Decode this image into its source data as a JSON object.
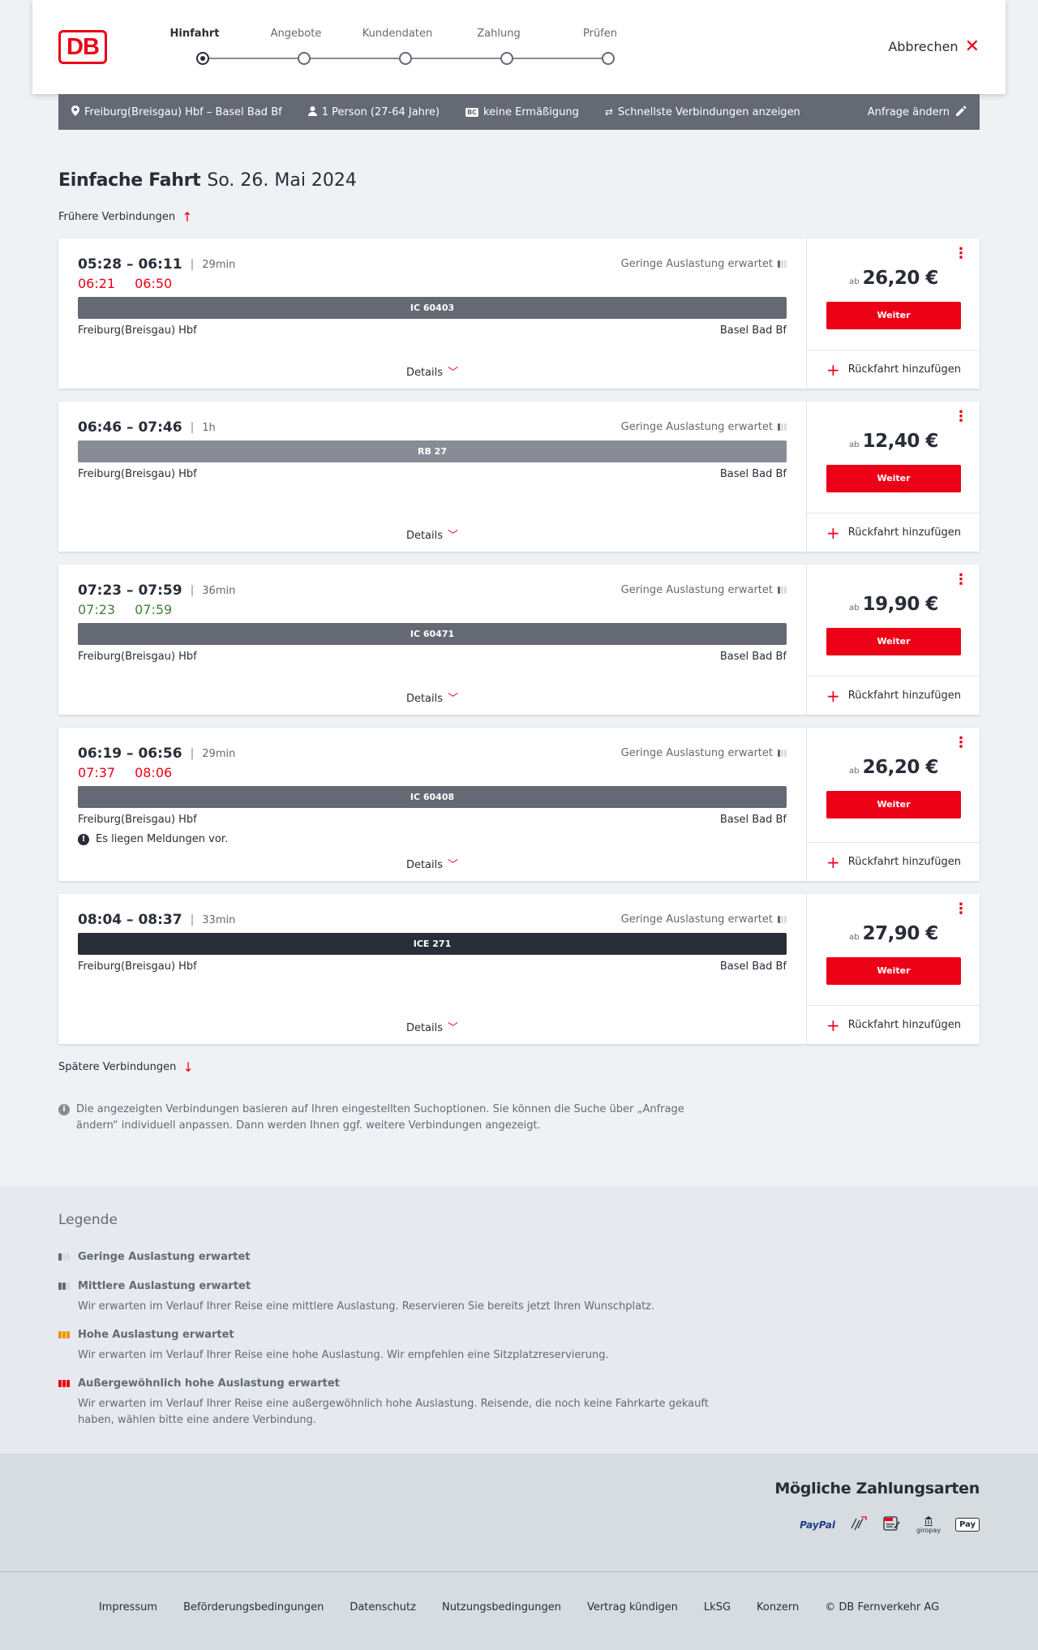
{
  "header": {
    "logo": "DB",
    "steps": [
      "Hinfahrt",
      "Angebote",
      "Kundendaten",
      "Zahlung",
      "Prüfen"
    ],
    "active_step": "Hinfahrt",
    "cancel_label": "Abbrechen"
  },
  "searchbar": {
    "route": "Freiburg(Breisgau) Hbf – Basel Bad Bf",
    "travellers": "1 Person (27-64 Jahre)",
    "discount": "keine Ermäßigung",
    "discount_badge": "BC",
    "fastest": "Schnellste Verbindungen anzeigen",
    "edit_label": "Anfrage ändern"
  },
  "page": {
    "title": "Einfache Fahrt",
    "date": "So. 26. Mai 2024",
    "earlier_label": "Frühere Verbindungen",
    "later_label": "Spätere Verbindungen",
    "note": "Die angezeigten Verbindungen basieren auf Ihren eingestellten Suchoptionen. Sie können die Suche über „Anfrage ändern“ individuell anpassen. Dann werden Ihnen ggf. weitere Verbindungen angezeigt."
  },
  "connections": [
    {
      "times": "05:28 – 06:11",
      "duration": "29min",
      "realtime": [
        "06:21",
        "06:50"
      ],
      "realtime_status": "late",
      "load": "Geringe Auslastung erwartet",
      "train": "IC 60403",
      "train_type": "ic",
      "from": "Freiburg(Breisgau) Hbf",
      "to": "Basel Bad Bf",
      "message": "",
      "price_prefix": "ab",
      "price": "26,20 €",
      "button": "Weiter",
      "details": "Details",
      "return": "Rückfahrt hinzufügen"
    },
    {
      "times": "06:46 – 07:46",
      "duration": "1h",
      "realtime": [],
      "realtime_status": "",
      "load": "Geringe Auslastung erwartet",
      "train": "RB 27",
      "train_type": "rb",
      "from": "Freiburg(Breisgau) Hbf",
      "to": "Basel Bad Bf",
      "message": "",
      "price_prefix": "ab",
      "price": "12,40 €",
      "button": "Weiter",
      "details": "Details",
      "return": "Rückfahrt hinzufügen"
    },
    {
      "times": "07:23 – 07:59",
      "duration": "36min",
      "realtime": [
        "07:23",
        "07:59"
      ],
      "realtime_status": "ontime",
      "load": "Geringe Auslastung erwartet",
      "train": "IC 60471",
      "train_type": "ic",
      "from": "Freiburg(Breisgau) Hbf",
      "to": "Basel Bad Bf",
      "message": "",
      "price_prefix": "ab",
      "price": "19,90 €",
      "button": "Weiter",
      "details": "Details",
      "return": "Rückfahrt hinzufügen"
    },
    {
      "times": "06:19 – 06:56",
      "duration": "29min",
      "realtime": [
        "07:37",
        "08:06"
      ],
      "realtime_status": "late",
      "load": "Geringe Auslastung erwartet",
      "train": "IC 60408",
      "train_type": "ic",
      "from": "Freiburg(Breisgau) Hbf",
      "to": "Basel Bad Bf",
      "message": "Es liegen Meldungen vor.",
      "price_prefix": "ab",
      "price": "26,20 €",
      "button": "Weiter",
      "details": "Details",
      "return": "Rückfahrt hinzufügen"
    },
    {
      "times": "08:04 – 08:37",
      "duration": "33min",
      "realtime": [],
      "realtime_status": "",
      "load": "Geringe Auslastung erwartet",
      "train": "ICE 271",
      "train_type": "ice",
      "from": "Freiburg(Breisgau) Hbf",
      "to": "Basel Bad Bf",
      "message": "",
      "price_prefix": "ab",
      "price": "27,90 €",
      "button": "Weiter",
      "details": "Details",
      "return": "Rückfahrt hinzufügen"
    }
  ],
  "legend": {
    "title": "Legende",
    "items": [
      {
        "title": "Geringe Auslastung erwartet",
        "desc": "",
        "level": 1
      },
      {
        "title": "Mittlere Auslastung erwartet",
        "desc": "Wir erwarten im Verlauf Ihrer Reise eine mittlere Auslastung. Reservieren Sie bereits jetzt Ihren Wunschplatz.",
        "level": 2
      },
      {
        "title": "Hohe Auslastung erwartet",
        "desc": "Wir erwarten im Verlauf Ihrer Reise eine hohe Auslastung. Wir empfehlen eine Sitzplatzreservierung.",
        "level": 3
      },
      {
        "title": "Außergewöhnlich hohe Auslastung erwartet",
        "desc": "Wir erwarten im Verlauf Ihrer Reise eine außergewöhnlich hohe Auslastung. Reisende, die noch keine Fahrkarte gekauft haben, wählen bitte eine andere Verbindung.",
        "level": 4
      }
    ]
  },
  "payment": {
    "title": "Mögliche Zahlungsarten",
    "methods": [
      "PayPal",
      "giropay",
      "Pay"
    ]
  },
  "footer": {
    "links": [
      "Impressum",
      "Beförderungsbedingungen",
      "Datenschutz",
      "Nutzungsbedingungen",
      "Vertrag kündigen",
      "LkSG",
      "Konzern",
      "© DB Fernverkehr AG"
    ]
  },
  "colors": {
    "brand": "#ec0016",
    "late": "#ec0016",
    "ontime": "#408335",
    "ic_bar": "#646973",
    "rb_bar": "#878c96",
    "ice_bar": "#282d37"
  }
}
